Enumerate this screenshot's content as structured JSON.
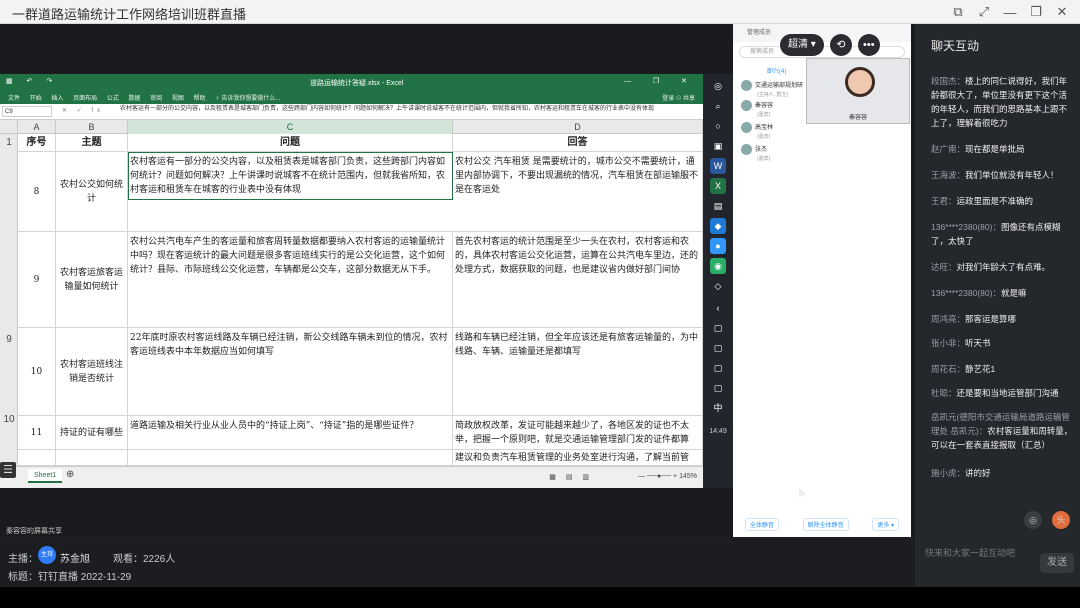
{
  "window": {
    "title": "一群道路运输统计工作网络培训班群直播",
    "controls": [
      "⧉",
      "⤢",
      "—",
      "❐",
      "✕"
    ]
  },
  "excel": {
    "titlebar": "道路运输统计答疑.xlsx - Excel",
    "quick_access": "▦ ↶ ↷",
    "window_controls": "— ❐ ✕",
    "ribbon_tabs": [
      "文件",
      "开始",
      "插入",
      "页面布局",
      "公式",
      "数据",
      "审阅",
      "视图",
      "帮助",
      "♀ 告诉我你想要做什么..."
    ],
    "ribbon_right": "登录  ⚇ 共享",
    "namebox": "C9",
    "fx": "✕ ✓ fx",
    "formula_text": "农村客运有一部分的公交内容，以及租赁表是城客部门负责，这些跨部门内容如何统计？问题如何解决？上午讲课时说城客不在统计范围内，但就我省所知，农村客运和租赁车在城客的行业表中没有体现",
    "columns": [
      "A",
      "B",
      "C",
      "D"
    ],
    "header_row": {
      "num": "1",
      "a": "序号",
      "b": "主题",
      "c": "问题",
      "d": "回答"
    },
    "rows": [
      {
        "num": "9",
        "a": "8",
        "b": "农村公交如何统计",
        "c": "农村客运有一部分的公交内容，以及租赁表是城客部门负责，这些跨部门内容如何统计？问题如何解决？上午讲课时说城客不在统计范围内，但就我省所知，农村客运和租赁车在城客的行业表中没有体现",
        "d": "农村公交 汽车租赁 是需要统计的，城市公交不需要统计，通里内部协调下，不要出现漏统的情况，汽车租赁在部运输服不是在客运处"
      },
      {
        "num": "10",
        "a": "9",
        "b": "农村客运旅客运输量如何统计",
        "c": "农村公共汽电车产生的客运量和旅客周转量数据都要纳入农村客运的运输量统计中吗？现在客运统计的最大问题是很多客运班线实行的是公交化运营，这个如何统计？县际、市际班线公交化运营，车辆都是公交车，这部分数据无从下手。",
        "d": "首先农村客运的统计范围是至少一头在农村，农村客运和农的，具体农村客运公交化运营，运算在公共汽电车里边，还的处理方式，数据获取的问题，也是建议省内做好部门间协"
      },
      {
        "num": "11",
        "a": "10",
        "b": "农村客运班线注销是否统计",
        "c": "22年底时原农村客运线路及车辆已经注销，新公交线路车辆未到位的情况，农村客运班线表中本年数据应当如何填写",
        "d": "线路和车辆已经注销，但全年应该还是有旅客运输量的，为中线路、车辆、运输量还是都填写"
      },
      {
        "num": "12",
        "a": "11",
        "b": "持证的证有哪些",
        "c": "道路运输及相关行业从业人员中的“持证上岗”、“持证”指的是哪些证件？",
        "d": "简政放权改革，发证可能越来越少了，各地区发的证也不太举，把握一个原则吧，就是交通运输管理部门发的证件都算"
      },
      {
        "num": "",
        "a": "",
        "b": "",
        "c": "",
        "d": "建议和负责汽车租赁管理的业务处室进行沟通，了解当前管"
      }
    ],
    "row_header_extra": [
      "9",
      "10",
      "11",
      "12"
    ],
    "sheet_tab": "Sheet1",
    "sheet_add": "⊕",
    "zoom": "— ──●── + 145%",
    "views": "▦ ▤ ▥"
  },
  "dingtalk": {
    "header": "管理成员",
    "search_placeholder": "搜索成员",
    "tab_label": "即兴(4)",
    "members": [
      {
        "name": "交通运输部规划研",
        "role": "(主持人, 群主)"
      },
      {
        "name": "秦容容",
        "role": "(嘉宾)"
      },
      {
        "name": "高宝林",
        "role": "(嘉宾)"
      },
      {
        "name": "张杰",
        "role": "(嘉宾)"
      }
    ],
    "buttons": [
      "全体静音",
      "解除全体静音",
      "更多 ▾"
    ]
  },
  "overlay": {
    "quality": "超清",
    "quality_arrow": "▾",
    "rotate_icon": "⟲",
    "more_icon": "•••"
  },
  "camera": {
    "name": "秦容容"
  },
  "taskbar": {
    "time": "14:49",
    "icons": [
      "◎",
      "⌕",
      "○",
      "▣",
      "W",
      "X",
      "▤",
      "◆",
      "●",
      "◉",
      "◇",
      "‹",
      "▢",
      "▢",
      "▢",
      "▢",
      "中"
    ]
  },
  "side": {
    "heading": "聊天互动",
    "messages": [
      {
        "who": "段国杰：",
        "text": "楼上的同仁说得好，我们年龄都很大了，单位里没有更下这个活的年轻人，而我们的思路基本上跟不上了，理解着很吃力"
      },
      {
        "who": "赵广南：",
        "text": "现在都是单批局"
      },
      {
        "who": "王海波：",
        "text": "我们单位就没有年轻人！"
      },
      {
        "who": "王君：",
        "text": "运政里面是不准确的"
      },
      {
        "who": "136****2380(80)：",
        "text": "图像还有点模糊了，太快了"
      },
      {
        "who": "达旺：",
        "text": "对我们年龄大了有点难。"
      },
      {
        "who": "136****2380(80)：",
        "text": "就是嘛"
      },
      {
        "who": "周鸿亮：",
        "text": "那客运是算哪"
      },
      {
        "who": "张小非：",
        "text": "听天书"
      },
      {
        "who": "周花石：",
        "text": "静艺花1"
      },
      {
        "who": "杜聪：",
        "text": "还是要和当地运管部门沟通"
      },
      {
        "who": "岳凯元(德阳市交通运输局道路运输管理处 岳凯元)：",
        "text": "农村客运量和周转量，可以在一套表直接报取（汇总）"
      },
      {
        "who": "施小虎：",
        "text": "讲的好"
      }
    ],
    "bottom_icons": [
      "◎",
      "头"
    ]
  },
  "info": {
    "host_label": "主播：",
    "host_badge": "主持",
    "host_name": "苏金旭",
    "viewers": "观看：2226人",
    "tag": "标题：钉钉直播 2022-11-29",
    "share_label": "秦容容的屏幕共享"
  },
  "chat_input": {
    "placeholder": "快来和大家一起互动吧",
    "send": "发送"
  },
  "menu_icon": "☰"
}
